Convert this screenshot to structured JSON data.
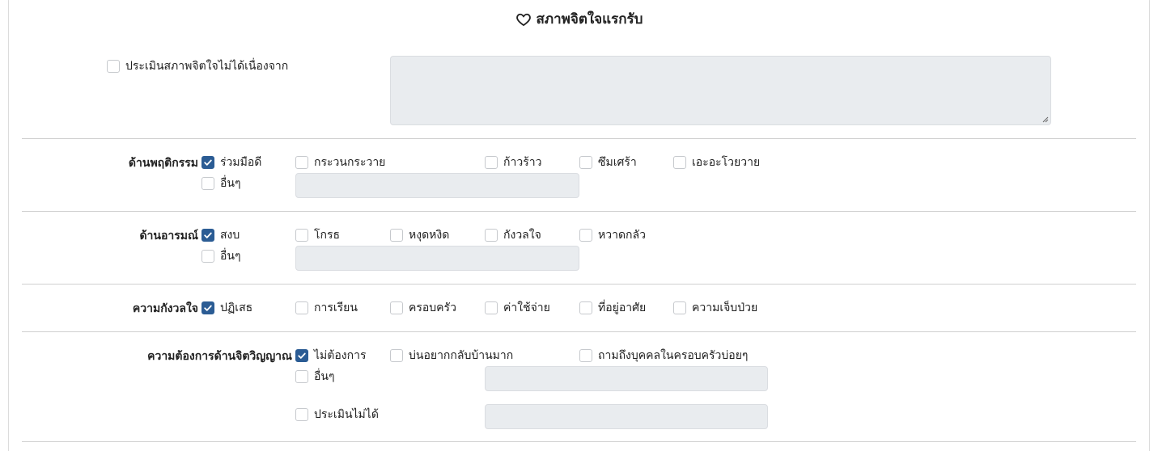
{
  "title": "สภาพจิตใจแรกรับ",
  "unable": {
    "label": "ประเมินสภาพจิตใจไม่ได้เนื่องจาก",
    "checked": false
  },
  "behavior": {
    "label": "ด้านพฤติกรรม",
    "options": [
      {
        "label": "ร่วมมือดี",
        "checked": true
      },
      {
        "label": "กระวนกระวาย",
        "checked": false
      },
      {
        "label": "ก้าวร้าว",
        "checked": false
      },
      {
        "label": "ซึมเศร้า",
        "checked": false
      },
      {
        "label": "เอะอะโวยวาย",
        "checked": false
      },
      {
        "label": "อื่นๆ",
        "checked": false
      }
    ]
  },
  "emotion": {
    "label": "ด้านอารมณ์",
    "options": [
      {
        "label": "สงบ",
        "checked": true
      },
      {
        "label": "โกรธ",
        "checked": false
      },
      {
        "label": "หงุดหงิด",
        "checked": false
      },
      {
        "label": "กังวลใจ",
        "checked": false
      },
      {
        "label": "หวาดกลัว",
        "checked": false
      },
      {
        "label": "อื่นๆ",
        "checked": false
      }
    ]
  },
  "anxiety": {
    "label": "ความกังวลใจ",
    "options": [
      {
        "label": "ปฏิเสธ",
        "checked": true
      },
      {
        "label": "การเรียน",
        "checked": false
      },
      {
        "label": "ครอบครัว",
        "checked": false
      },
      {
        "label": "ค่าใช้จ่าย",
        "checked": false
      },
      {
        "label": "ที่อยู่อาศัย",
        "checked": false
      },
      {
        "label": "ความเจ็บป่วย",
        "checked": false
      }
    ]
  },
  "spiritual": {
    "label": "ความต้องการด้านจิตวิญญาณ",
    "options": [
      {
        "label": "ไม่ต้องการ",
        "checked": true
      },
      {
        "label": "บ่นอยากกลับบ้านมาก",
        "checked": false
      },
      {
        "label": "ถามถึงบุคคลในครอบครัวบ่อยๆ",
        "checked": false
      },
      {
        "label": "อื่นๆ",
        "checked": false
      },
      {
        "label": "ประเมินไม่ได้",
        "checked": false
      }
    ]
  }
}
